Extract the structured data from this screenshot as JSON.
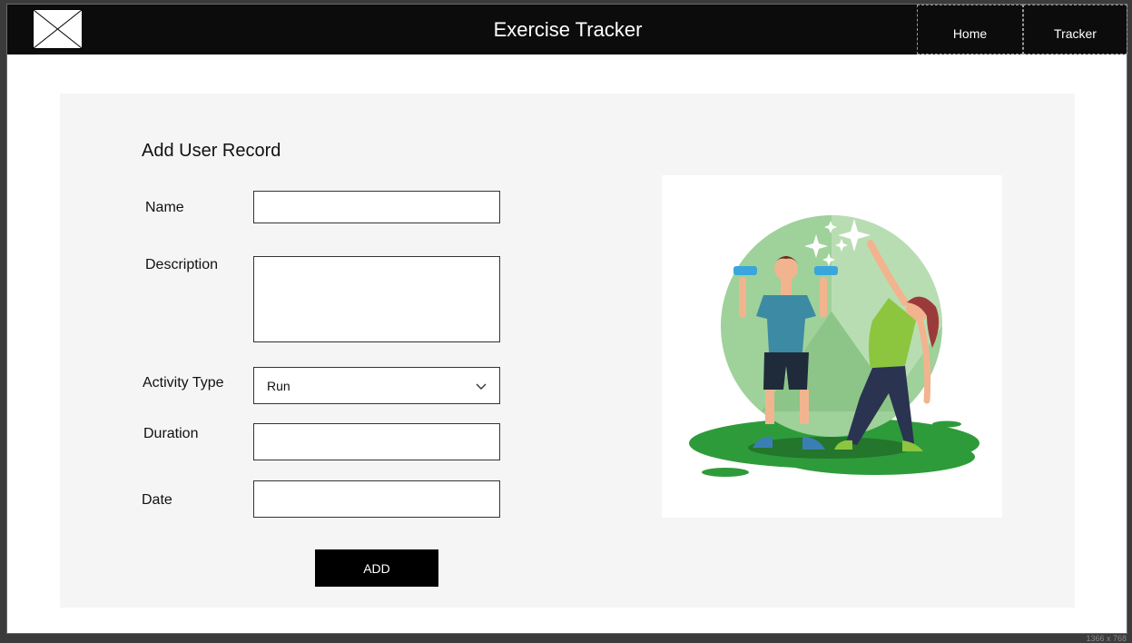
{
  "header": {
    "logo_icon": "image-placeholder-icon",
    "title": "Exercise Tracker",
    "nav": [
      {
        "label": "Home"
      },
      {
        "label": "Tracker"
      }
    ]
  },
  "form": {
    "heading": "Add User Record",
    "name_label": "Name",
    "name_value": "",
    "description_label": "Description",
    "description_value": "",
    "activity_label": "Activity Type",
    "activity_selected": "Run",
    "duration_label": "Duration",
    "duration_value": "",
    "date_label": "Date",
    "date_value": "",
    "submit_label": "ADD"
  },
  "illustration": {
    "icon": "exercise-people-illustration"
  },
  "colors": {
    "topbar": "#0c0c0c",
    "panel": "#f5f5f5",
    "button": "#000000",
    "green_dark": "#2e9b3a",
    "green_light": "#9fd19a"
  },
  "footer": {
    "resolution_note": "1366 x 768"
  }
}
